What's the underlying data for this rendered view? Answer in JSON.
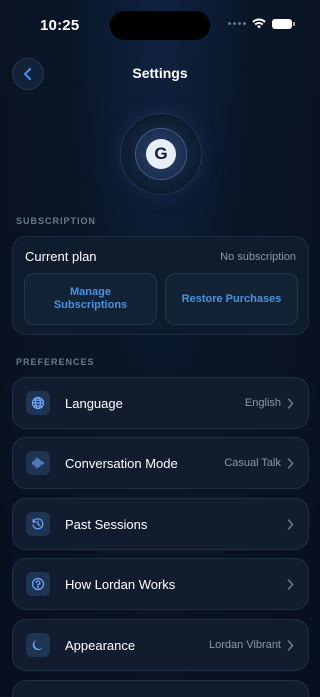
{
  "status_bar": {
    "time": "10:25"
  },
  "nav": {
    "title": "Settings"
  },
  "avatar": {
    "initial": "G"
  },
  "subscription": {
    "section_label": "SUBSCRIPTION",
    "current_plan_label": "Current plan",
    "current_plan_value": "No subscription",
    "manage_line1": "Manage",
    "manage_line2": "Subscriptions",
    "restore_label": "Restore Purchases"
  },
  "preferences": {
    "section_label": "PREFERENCES",
    "items": [
      {
        "label": "Language",
        "value": "English",
        "icon": "globe-icon"
      },
      {
        "label": "Conversation Mode",
        "value": "Casual Talk",
        "icon": "waveform-icon"
      },
      {
        "label": "Past Sessions",
        "value": "",
        "icon": "history-icon"
      },
      {
        "label": "How Lordan Works",
        "value": "",
        "icon": "question-icon"
      },
      {
        "label": "Appearance",
        "value": "Lordan Vibrant",
        "icon": "moon-icon"
      }
    ]
  },
  "colors": {
    "accent": "#4a90e2",
    "background": "#0a1628",
    "card": "#111d2e"
  }
}
